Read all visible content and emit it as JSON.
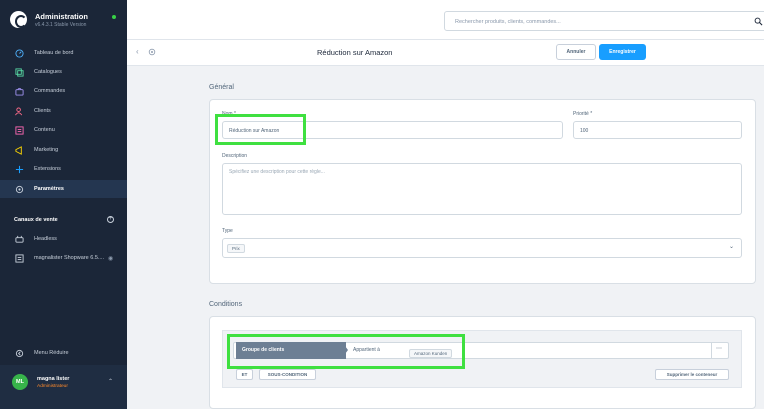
{
  "sidebar": {
    "title": "Administration",
    "version": "v6.4.3.1 Stable Version",
    "items": [
      {
        "label": "Tableau de bord",
        "icon": "dashboard-icon"
      },
      {
        "label": "Catalogues",
        "icon": "catalogue-icon"
      },
      {
        "label": "Commandes",
        "icon": "orders-icon"
      },
      {
        "label": "Clients",
        "icon": "customers-icon"
      },
      {
        "label": "Contenu",
        "icon": "content-icon"
      },
      {
        "label": "Marketing",
        "icon": "marketing-icon"
      },
      {
        "label": "Extensions",
        "icon": "extensions-icon"
      },
      {
        "label": "Paramètres",
        "icon": "settings-icon",
        "active": true
      }
    ],
    "sales_channels_title": "Canaux de vente",
    "channels": [
      {
        "label": "Headless",
        "icon": "headless-icon"
      },
      {
        "label": "magnalister Shopware 6.5....",
        "icon": "storefront-icon"
      }
    ],
    "collapse_label": "Menu Réduire",
    "user": {
      "initials": "ML",
      "name": "magna lister",
      "role": "Administrateur"
    }
  },
  "search": {
    "placeholder": "Rechercher produits, clients, commandes..."
  },
  "page": {
    "title": "Réduction sur Amazon",
    "cancel_label": "Annuler",
    "save_label": "Enregistrer"
  },
  "general": {
    "section_title": "Général",
    "name_label": "Nom *",
    "name_value": "Réduction sur Amazon",
    "priority_label": "Priorité *",
    "priority_value": "100",
    "description_label": "Description",
    "description_placeholder": "Spécifiez une description pour cette règle...",
    "type_label": "Type",
    "type_tag": "Prix"
  },
  "conditions": {
    "section_title": "Conditions",
    "field": "Groupe de clients",
    "operator": "Appartient à",
    "value_tag": "Amazon Kunden",
    "and_label": "ET",
    "subcondition_label": "SOUS-CONDITION",
    "delete_container_label": "Supprimer le conteneur"
  },
  "colors": {
    "sidebar_bg": "#1b2638",
    "primary": "#189eff",
    "highlight": "#3fe040",
    "avatar": "#37b34a",
    "role": "#ff8a2b"
  }
}
